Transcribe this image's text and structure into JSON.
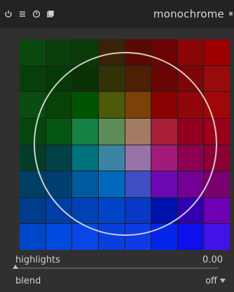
{
  "module": {
    "title": "monochrome",
    "icons": [
      "power-icon",
      "presets-menu-icon",
      "reset-icon",
      "multi-instance-icon"
    ]
  },
  "grid": {
    "rows": [
      [
        "#0b4a0f",
        "#0a3f0c",
        "#0b3a07",
        "#3a2206",
        "#5a0a05",
        "#6d0404",
        "#8a0606",
        "#9c0000"
      ],
      [
        "#063f0a",
        "#053a08",
        "#0a3205",
        "#313307",
        "#4d2006",
        "#6a0505",
        "#7f0608",
        "#980b0b"
      ],
      [
        "#0b4c11",
        "#074305",
        "#005600",
        "#4c5a09",
        "#7a4207",
        "#8b0202",
        "#910609",
        "#a00708"
      ],
      [
        "#06460f",
        "#045510",
        "#138243",
        "#5c8d58",
        "#a57a63",
        "#aa1f38",
        "#94001f",
        "#9b0018"
      ],
      [
        "#033d2a",
        "#004245",
        "#00737d",
        "#3a84a3",
        "#9873a8",
        "#a21b7a",
        "#8e0050",
        "#8c0034"
      ],
      [
        "#004066",
        "#003f72",
        "#005a9f",
        "#0069bd",
        "#3d4fc2",
        "#6c07b2",
        "#720095",
        "#7a006e"
      ],
      [
        "#003c8c",
        "#003da4",
        "#0042b6",
        "#0044ca",
        "#0838c6",
        "#0012ad",
        "#3200b0",
        "#6e00b3"
      ],
      [
        "#0046c9",
        "#004ae0",
        "#0a45e6",
        "#0a3fdf",
        "#0f3be6",
        "#0526ea",
        "#0d10ea",
        "#4312ea"
      ]
    ]
  },
  "highlights": {
    "label": "highlights",
    "value": "0.00",
    "fraction": 0.0
  },
  "blend": {
    "label": "blend",
    "value": "off"
  }
}
